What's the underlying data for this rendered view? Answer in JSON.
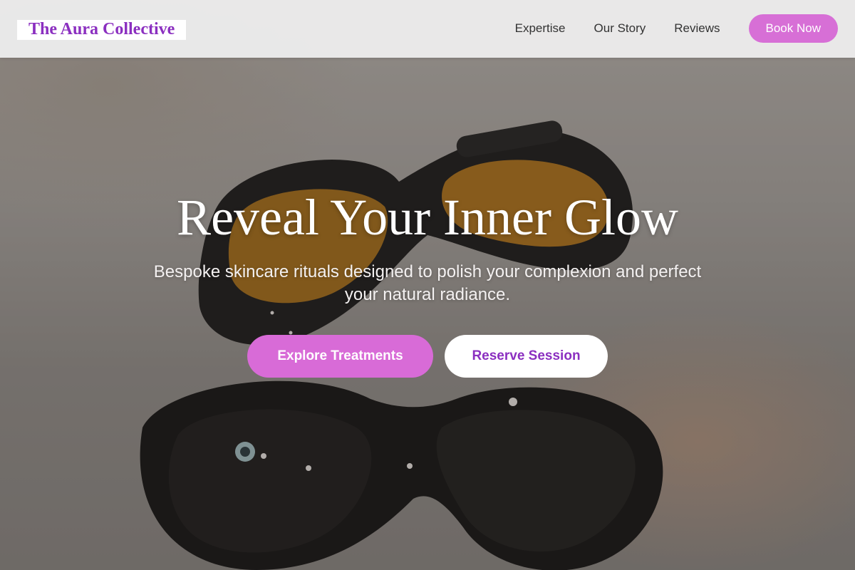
{
  "header": {
    "brand": "The Aura Collective",
    "nav": [
      {
        "label": "Expertise"
      },
      {
        "label": "Our Story"
      },
      {
        "label": "Reviews"
      }
    ],
    "book_button": "Book Now"
  },
  "hero": {
    "title": "Reveal Your Inner Glow",
    "subtitle": "Bespoke skincare rituals designed to polish your complexion and perfect your natural radiance.",
    "primary_cta": "Explore Treatments",
    "secondary_cta": "Reserve Session",
    "background_image": "safety-glasses-photo"
  },
  "colors": {
    "brand_purple": "#8b2fc0",
    "accent_pink": "#d76fd6",
    "header_bg": "#ececec"
  }
}
